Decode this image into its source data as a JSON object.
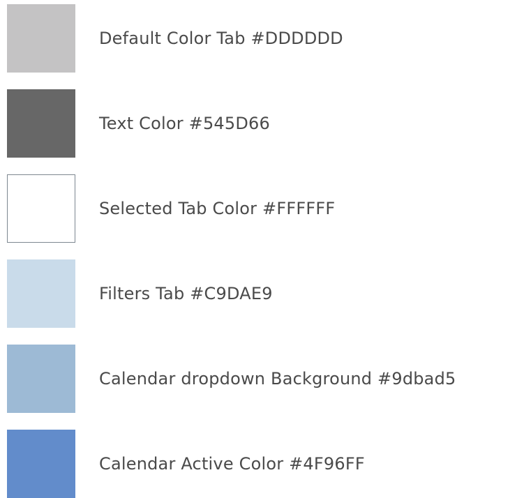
{
  "swatches": [
    {
      "label": "Default Color Tab #DDDDDD",
      "color": "#c4c3c4",
      "outlined": false
    },
    {
      "label": "Text Color #545D66",
      "color": "#676767",
      "outlined": false
    },
    {
      "label": "Selected Tab Color #FFFFFF",
      "color": "#ffffff",
      "outlined": true
    },
    {
      "label": "Filters Tab #C9DAE9",
      "color": "#c9dbea",
      "outlined": false
    },
    {
      "label": "Calendar dropdown Background #9dbad5",
      "color": "#9dbad5",
      "outlined": false
    },
    {
      "label": "Calendar Active Color #4F96FF",
      "color": "#628ccb",
      "outlined": false
    }
  ]
}
